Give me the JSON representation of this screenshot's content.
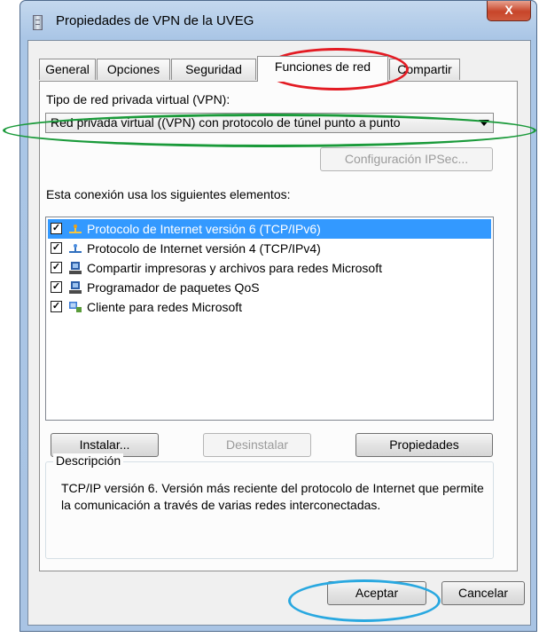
{
  "window": {
    "title": "Propiedades de VPN de la UVEG",
    "close_label": "X"
  },
  "tabs": [
    {
      "label": "General"
    },
    {
      "label": "Opciones"
    },
    {
      "label": "Seguridad"
    },
    {
      "label": "Funciones de red",
      "active": true
    },
    {
      "label": "Compartir"
    }
  ],
  "vpn": {
    "type_label": "Tipo de red privada virtual (VPN):",
    "type_value": "Red privada virtual ((VPN) con protocolo de túnel punto a punto",
    "ipsec_button": "Configuración IPSec..."
  },
  "components": {
    "label": "Esta conexión usa los siguientes elementos:",
    "items": [
      {
        "label": "Protocolo de Internet versión 6 (TCP/IPv6)",
        "checked": true,
        "icon": "network-protocol-icon",
        "selected": true
      },
      {
        "label": "Protocolo de Internet versión 4 (TCP/IPv4)",
        "checked": true,
        "icon": "network-protocol-icon"
      },
      {
        "label": "Compartir impresoras y archivos para redes Microsoft",
        "checked": true,
        "icon": "network-service-icon"
      },
      {
        "label": "Programador de paquetes QoS",
        "checked": true,
        "icon": "network-service-icon"
      },
      {
        "label": "Cliente para redes Microsoft",
        "checked": true,
        "icon": "network-client-icon"
      }
    ],
    "check_mark": "✓"
  },
  "buttons": {
    "install": "Instalar...",
    "uninstall": "Desinstalar",
    "properties": "Propiedades",
    "ok": "Aceptar",
    "cancel": "Cancelar"
  },
  "description": {
    "legend": "Descripción",
    "text": "TCP/IP versión 6. Versión más reciente del protocolo de Internet que permite la comunicación a través de varias redes interconectadas."
  },
  "colors": {
    "highlight_red": "#e31b23",
    "highlight_green": "#1a9a3a",
    "highlight_blue": "#29a8e0",
    "selection": "#3399ff"
  }
}
